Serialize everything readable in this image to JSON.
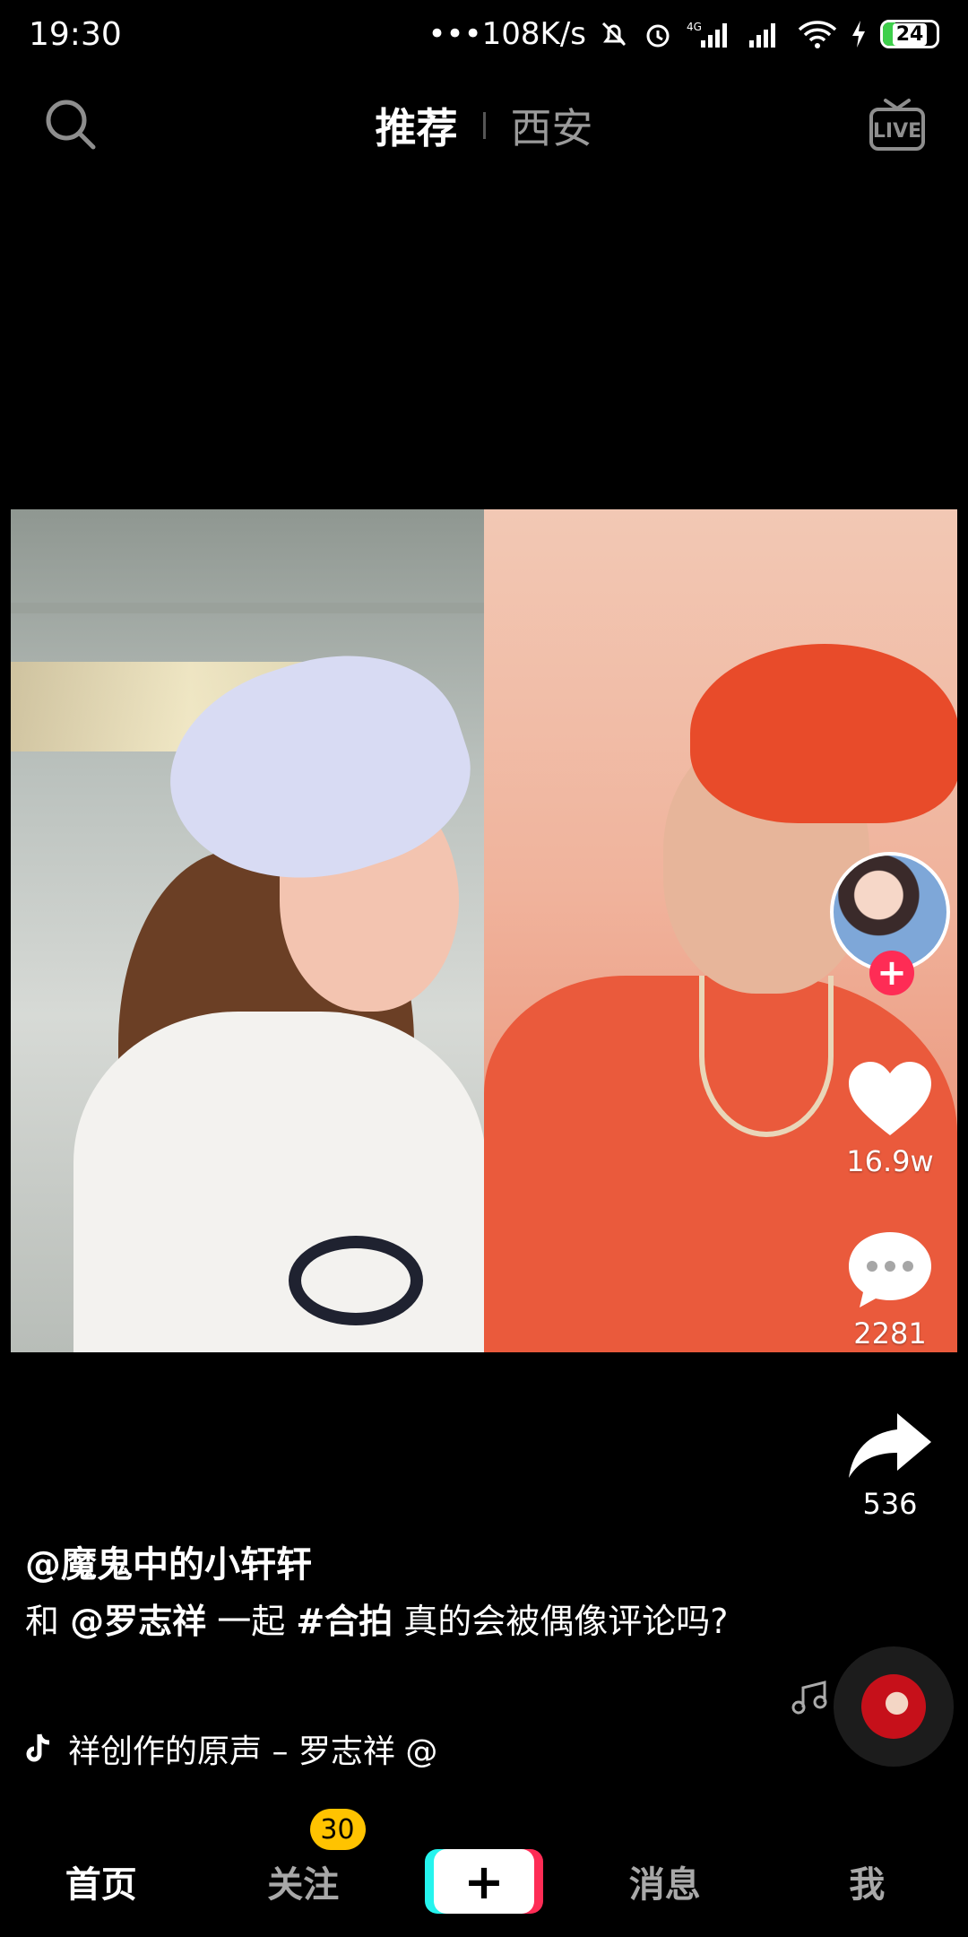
{
  "status_bar": {
    "time": "19:30",
    "network_speed": "•••108K/s",
    "battery": "24",
    "icons": [
      "mute-bell-icon",
      "alarm-icon",
      "signal-4g-icon",
      "signal-icon",
      "wifi-icon",
      "charging-icon",
      "battery-icon"
    ]
  },
  "top_nav": {
    "tabs": [
      {
        "label": "推荐",
        "active": true
      },
      {
        "label": "西安",
        "active": false
      }
    ],
    "search_icon": "search-icon",
    "live_icon": "live-icon",
    "live_text": "LIVE"
  },
  "side_actions": {
    "avatar_follow": "+",
    "likes": "16.9w",
    "comments": "2281",
    "shares": "536"
  },
  "caption": {
    "author": "@魔鬼中的小轩轩",
    "desc_prefix": "和",
    "mention": "@罗志祥",
    "desc_mid": "一起",
    "hashtag": "#合拍",
    "desc_suffix": "真的会被偶像评论吗?",
    "music": "祥创作的原声 – 罗志祥   @"
  },
  "bottom_nav": {
    "items": [
      {
        "label": "首页",
        "active": true
      },
      {
        "label": "关注",
        "badge": "30"
      },
      {
        "label": "消息"
      },
      {
        "label": "我"
      }
    ],
    "create_label": "+"
  },
  "colors": {
    "accent_red": "#fe2c55",
    "accent_cyan": "#25f4ee",
    "badge_yellow": "#ffc300"
  }
}
